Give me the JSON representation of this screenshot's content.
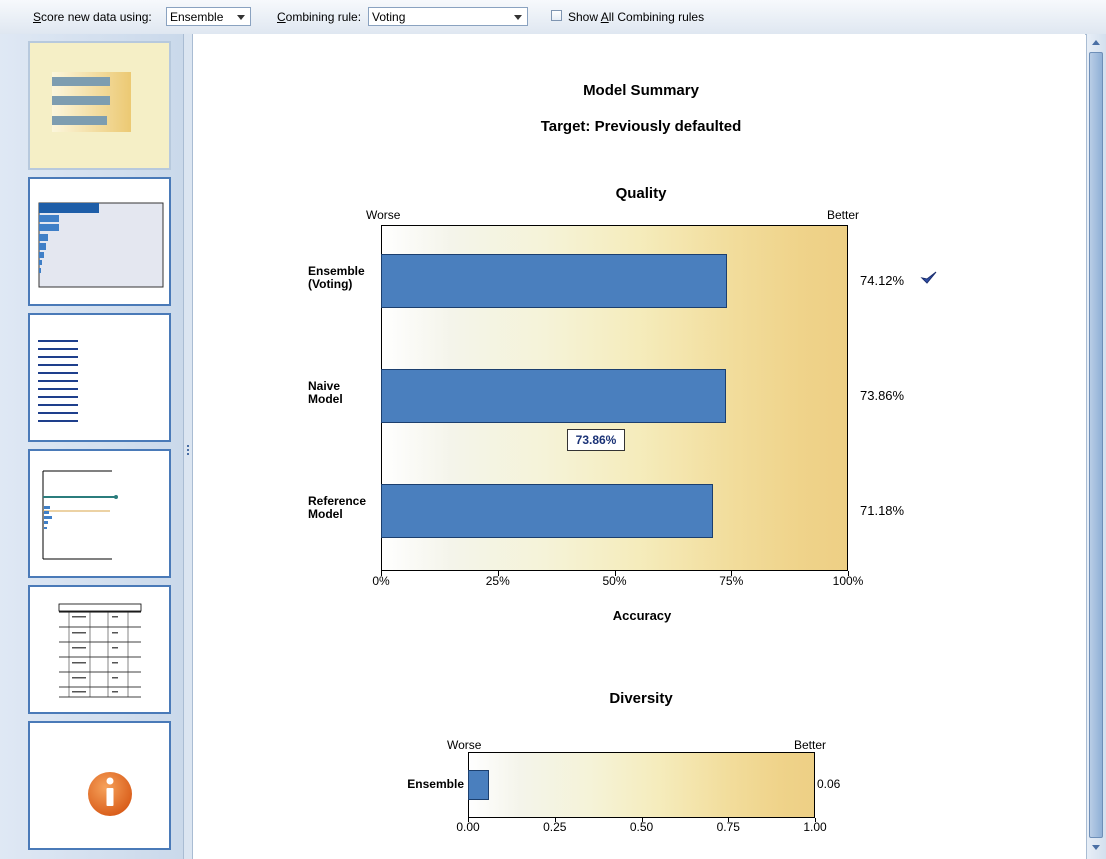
{
  "toolbar": {
    "score_label_prefix": "S",
    "score_label_rest": "core new data using:",
    "score_value": "Ensemble",
    "combining_label_prefix": "C",
    "combining_label_rest": "ombining rule:",
    "combining_value": "Voting",
    "show_all_label_pre": "Show ",
    "show_all_label_ul": "A",
    "show_all_label_post": "ll Combining rules",
    "show_all_checked": false
  },
  "thumbnails": [
    {
      "name": "model-summary",
      "selected": true
    },
    {
      "name": "predictor-importance",
      "selected": false
    },
    {
      "name": "predictor-frequency",
      "selected": false
    },
    {
      "name": "component-model-accuracy",
      "selected": false
    },
    {
      "name": "component-model-details",
      "selected": false
    },
    {
      "name": "information",
      "selected": false
    }
  ],
  "summary": {
    "title": "Model Summary",
    "target": "Target: Previously defaulted"
  },
  "quality": {
    "title": "Quality",
    "worse_label": "Worse",
    "better_label": "Better",
    "xlabel": "Accuracy",
    "tooltip": "73.86%"
  },
  "diversity": {
    "title": "Diversity",
    "worse_label": "Worse",
    "better_label": "Better"
  },
  "chart_data": [
    {
      "type": "bar",
      "title": "Quality",
      "categories": [
        "Ensemble (Voting)",
        "Naive Model",
        "Reference Model"
      ],
      "category_lines": [
        [
          "Ensemble",
          "(Voting)"
        ],
        [
          "Naive",
          "Model"
        ],
        [
          "Reference",
          "Model"
        ]
      ],
      "values": [
        74.12,
        73.86,
        71.18
      ],
      "value_labels": [
        "74.12%",
        "73.86%",
        "71.18%"
      ],
      "xlabel": "Accuracy",
      "xlim": [
        0,
        100
      ],
      "ticks": [
        "0%",
        "25%",
        "50%",
        "75%",
        "100%"
      ],
      "best": "Ensemble (Voting)"
    },
    {
      "type": "bar",
      "title": "Diversity",
      "categories": [
        "Ensemble"
      ],
      "values": [
        0.06
      ],
      "value_labels": [
        "0.06"
      ],
      "xlim": [
        0,
        1
      ],
      "ticks": [
        "0.00",
        "0.25",
        "0.50",
        "0.75",
        "1.00"
      ]
    }
  ],
  "colors": {
    "bar": "#4a7fbe",
    "accent": "#4a7ab8"
  }
}
